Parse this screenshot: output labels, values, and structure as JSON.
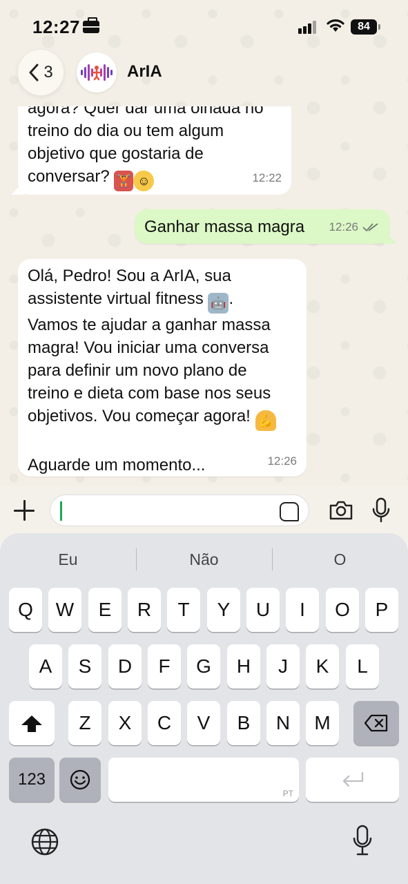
{
  "status_bar": {
    "time": "12:27",
    "battery": "84"
  },
  "header": {
    "back_count": "3",
    "contact_name": "ArIA"
  },
  "messages": [
    {
      "direction": "incoming",
      "text": "agora? Quer dar uma olhada no\ntreino do dia ou tem algum\nobjetivo que gostaria de\nconversar?",
      "emojis": [
        "weightlifter",
        "smiling-face"
      ],
      "time": "12:22"
    },
    {
      "direction": "outgoing",
      "text": "Ganhar massa magra",
      "time": "12:26",
      "status": "read"
    },
    {
      "direction": "incoming",
      "text_lines": [
        "Olá, Pedro! Sou a ArIA, sua",
        "assistente virtual fitness",
        "Vamos te ajudar a ganhar massa",
        "magra! Vou iniciar uma conversa",
        "para definir um novo plano de",
        "treino e dieta com base nos seus",
        "objetivos. Vou começar agora!",
        "",
        "Aguarde um momento..."
      ],
      "emojis": [
        "robot",
        "flexed-biceps"
      ],
      "time": "12:26"
    }
  ],
  "composer": {
    "value": ""
  },
  "keyboard": {
    "suggestions": [
      "Eu",
      "Não",
      "O"
    ],
    "row1": [
      "Q",
      "W",
      "E",
      "R",
      "T",
      "Y",
      "U",
      "I",
      "O",
      "P"
    ],
    "row2": [
      "A",
      "S",
      "D",
      "F",
      "G",
      "H",
      "J",
      "K",
      "L"
    ],
    "row3": [
      "Z",
      "X",
      "C",
      "V",
      "B",
      "N",
      "M"
    ],
    "numbers_label": "123",
    "space_lang": "PT"
  },
  "colors": {
    "outgoing_bubble": "#dcf8c6",
    "incoming_bubble": "#ffffff",
    "caret": "#1fa855",
    "background": "#f3efe6"
  }
}
